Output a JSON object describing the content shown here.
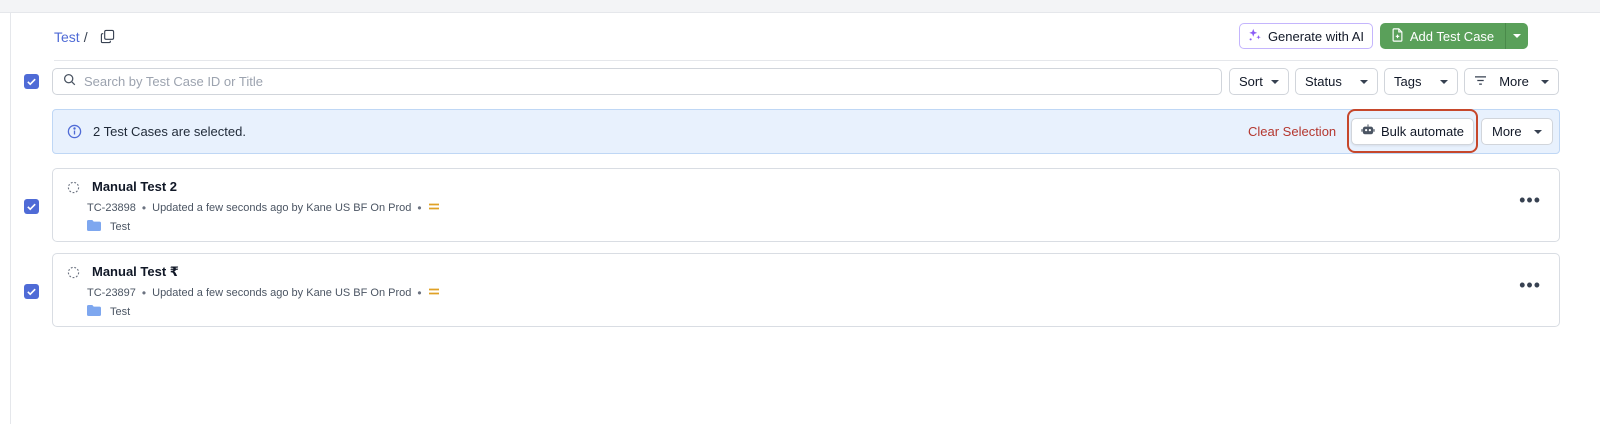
{
  "breadcrumb": {
    "link": "Test",
    "separator": "/"
  },
  "header": {
    "generate_ai_label": "Generate with AI",
    "add_test_case_label": "Add Test Case"
  },
  "search": {
    "placeholder": "Search by Test Case ID or Title",
    "value": ""
  },
  "filters": {
    "sort_label": "Sort",
    "status_label": "Status",
    "tags_label": "Tags",
    "more_label": "More"
  },
  "selection_banner": {
    "message": "2 Test Cases are selected.",
    "clear_label": "Clear Selection",
    "bulk_automate_label": "Bulk automate",
    "more_label": "More"
  },
  "test_cases": [
    {
      "title": "Manual Test 2",
      "id": "TC-23898",
      "updated": "Updated a few seconds ago by Kane US BF On Prod",
      "folder": "Test",
      "selected": true
    },
    {
      "title": "Manual Test ₹",
      "id": "TC-23897",
      "updated": "Updated a few seconds ago by Kane US BF On Prod",
      "folder": "Test",
      "selected": true
    }
  ],
  "colors": {
    "accent": "#4f6bd6",
    "add_button": "#5aa05a",
    "banner_bg": "#e8f1fd",
    "clear_text": "#b4372f",
    "highlight_outline": "#c6472b",
    "priority": "#e0a126",
    "folder": "#7ea7ef"
  },
  "icons": {
    "copy": "copy-icon",
    "ai": "sparkle-icon",
    "add": "file-plus-icon",
    "search": "search-icon",
    "filter": "filter-lines-icon",
    "info": "info-icon",
    "bulk": "robot-icon",
    "status": "dashed-circle-icon",
    "priority": "equals-icon",
    "folder": "folder-icon",
    "kebab": "more-horizontal-icon"
  }
}
